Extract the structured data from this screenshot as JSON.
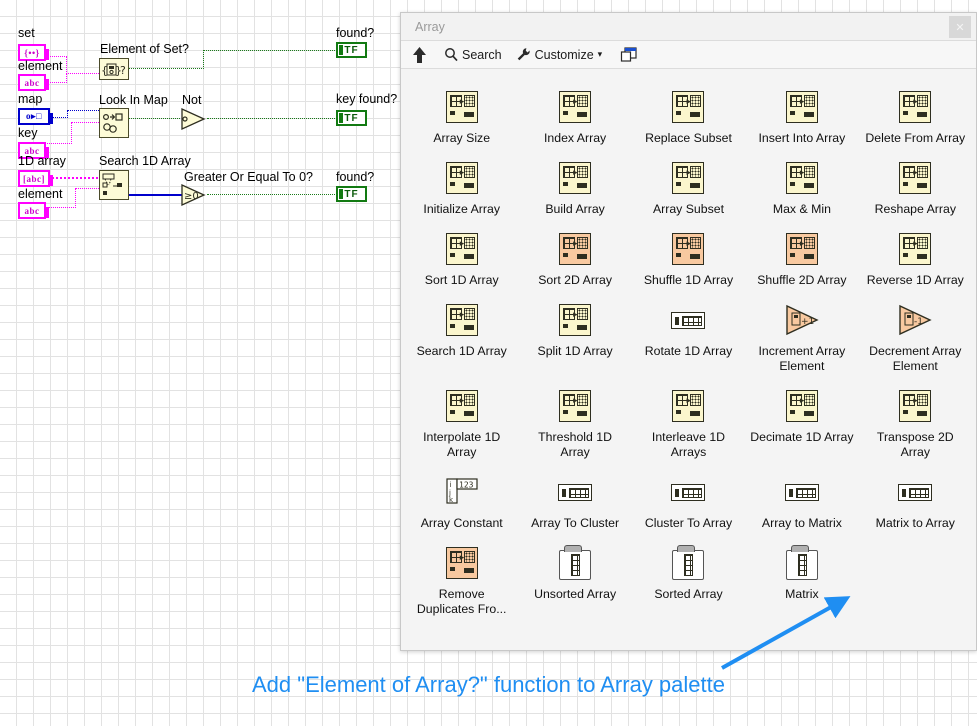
{
  "diagram": {
    "terminals": [
      {
        "label": "set",
        "glyph": "{••}",
        "color": "magenta"
      },
      {
        "label": "element",
        "glyph": "abc",
        "color": "magenta"
      },
      {
        "label": "map",
        "glyph": "o▸□",
        "color": "blue"
      },
      {
        "label": "key",
        "glyph": "abc",
        "color": "magenta"
      },
      {
        "label": "1D array",
        "glyph": "[abc]",
        "color": "magenta"
      },
      {
        "label": "element",
        "glyph": "abc",
        "color": "magenta"
      }
    ],
    "nodes": [
      {
        "label": "Element of Set?"
      },
      {
        "label": "Look In Map"
      },
      {
        "label": "Search 1D Array"
      },
      {
        "label": "Not"
      },
      {
        "label": "Greater Or Equal To 0?"
      }
    ],
    "indicators": [
      {
        "label": "found?",
        "value": "TF"
      },
      {
        "label": "key found?",
        "value": "TF"
      },
      {
        "label": "found?",
        "value": "TF"
      }
    ]
  },
  "palette": {
    "title": "Array",
    "close_label": "✕",
    "toolbar": {
      "up_icon": "up-arrow-icon",
      "search_label": "Search",
      "customize_label": "Customize",
      "customize_caret": "▾",
      "pin_icon": "pin-window-icon"
    },
    "items": [
      {
        "name": "Array Size",
        "style": "box",
        "icon": "array-size-icon"
      },
      {
        "name": "Index Array",
        "style": "box",
        "icon": "index-array-icon"
      },
      {
        "name": "Replace Subset",
        "style": "box",
        "icon": "replace-subset-icon"
      },
      {
        "name": "Insert Into Array",
        "style": "box",
        "icon": "insert-into-array-icon"
      },
      {
        "name": "Delete From Array",
        "style": "box",
        "icon": "delete-from-array-icon"
      },
      {
        "name": "Initialize Array",
        "style": "box",
        "icon": "initialize-array-icon"
      },
      {
        "name": "Build Array",
        "style": "box",
        "icon": "build-array-icon"
      },
      {
        "name": "Array Subset",
        "style": "box",
        "icon": "array-subset-icon"
      },
      {
        "name": "Max & Min",
        "style": "box",
        "icon": "max-min-icon"
      },
      {
        "name": "Reshape Array",
        "style": "box",
        "icon": "reshape-array-icon"
      },
      {
        "name": "Sort 1D Array",
        "style": "box",
        "icon": "sort-1d-array-icon"
      },
      {
        "name": "Sort 2D Array",
        "style": "orange",
        "icon": "sort-2d-array-icon"
      },
      {
        "name": "Shuffle 1D Array",
        "style": "orange",
        "icon": "shuffle-1d-array-icon"
      },
      {
        "name": "Shuffle 2D Array",
        "style": "orange",
        "icon": "shuffle-2d-array-icon"
      },
      {
        "name": "Reverse 1D Array",
        "style": "box",
        "icon": "reverse-1d-array-icon"
      },
      {
        "name": "Search 1D Array",
        "style": "box",
        "icon": "search-1d-array-icon"
      },
      {
        "name": "Split 1D Array",
        "style": "box",
        "icon": "split-1d-array-icon"
      },
      {
        "name": "Rotate 1D Array",
        "style": "wide",
        "icon": "rotate-1d-array-icon"
      },
      {
        "name": "Increment Array Element",
        "style": "tri",
        "icon": "increment-array-element-icon"
      },
      {
        "name": "Decrement Array Element",
        "style": "tri",
        "icon": "decrement-array-element-icon"
      },
      {
        "name": "Interpolate 1D Array",
        "style": "box",
        "icon": "interpolate-1d-array-icon"
      },
      {
        "name": "Threshold 1D Array",
        "style": "box",
        "icon": "threshold-1d-array-icon"
      },
      {
        "name": "Interleave 1D Arrays",
        "style": "box",
        "icon": "interleave-1d-arrays-icon"
      },
      {
        "name": "Decimate 1D Array",
        "style": "box",
        "icon": "decimate-1d-array-icon"
      },
      {
        "name": "Transpose 2D Array",
        "style": "box",
        "icon": "transpose-2d-array-icon"
      },
      {
        "name": "Array Constant",
        "style": "const",
        "icon": "array-constant-icon"
      },
      {
        "name": "Array To Cluster",
        "style": "wide",
        "icon": "array-to-cluster-icon"
      },
      {
        "name": "Cluster To Array",
        "style": "wide",
        "icon": "cluster-to-array-icon"
      },
      {
        "name": "Array to Matrix",
        "style": "wide",
        "icon": "array-to-matrix-icon"
      },
      {
        "name": "Matrix to Array",
        "style": "wide",
        "icon": "matrix-to-array-icon"
      },
      {
        "name": "Remove Duplicates Fro...",
        "style": "orange",
        "icon": "remove-duplicates-icon"
      },
      {
        "name": "Unsorted Array",
        "style": "folder",
        "icon": "unsorted-array-folder-icon"
      },
      {
        "name": "Sorted Array",
        "style": "folder",
        "icon": "sorted-array-folder-icon"
      },
      {
        "name": "Matrix",
        "style": "folder",
        "icon": "matrix-folder-icon"
      }
    ]
  },
  "annotation": {
    "caption": "Add \"Element of Array?\" function to Array palette",
    "color": "#1f8ef2"
  }
}
